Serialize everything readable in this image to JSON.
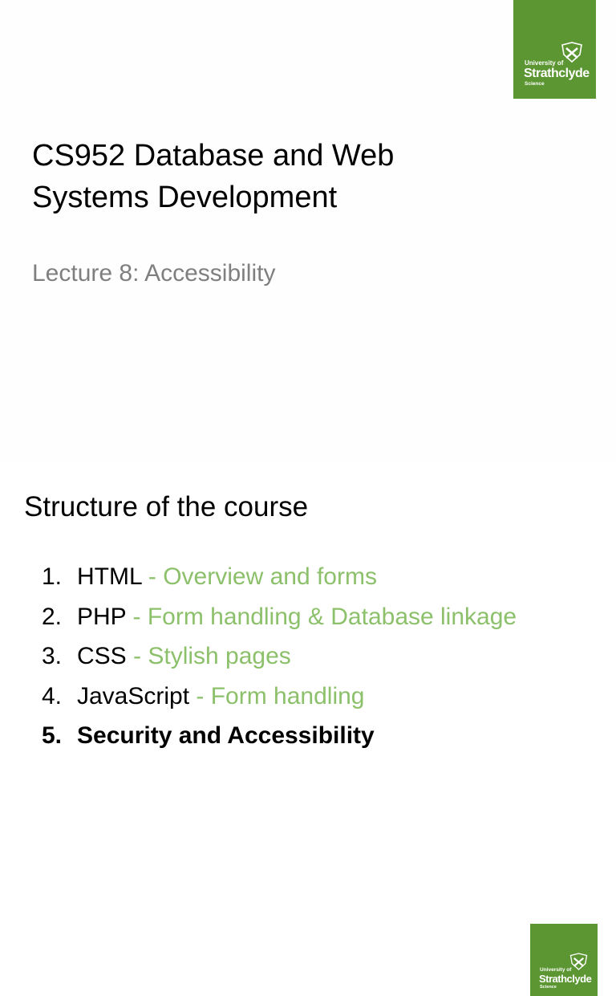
{
  "logo": {
    "line1": "University of",
    "line2": "Strathclyde",
    "line3": "Science",
    "color": "#5b9632"
  },
  "slide1": {
    "title_line1": "CS952 Database and Web",
    "title_line2": "Systems Development",
    "subtitle": "Lecture 8: Accessibility"
  },
  "slide2": {
    "title": "Structure of the course",
    "items": [
      {
        "num": "1.",
        "main": "HTML",
        "desc": " - Overview and forms"
      },
      {
        "num": "2.",
        "main": "PHP",
        "desc": " - Form handling & Database linkage"
      },
      {
        "num": "3.",
        "main": "CSS",
        "desc": " - Stylish pages"
      },
      {
        "num": "4.",
        "main": "JavaScript",
        "desc": " - Form handling"
      },
      {
        "num": "5.",
        "main": "Security and Accessibility",
        "desc": ""
      }
    ]
  }
}
